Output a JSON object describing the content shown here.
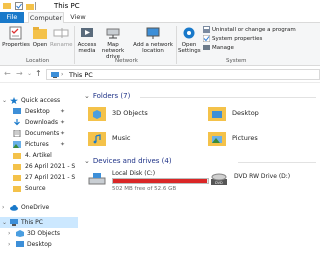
{
  "window": {
    "title": "This PC"
  },
  "tabs": {
    "file": "File",
    "computer": "Computer",
    "view": "View"
  },
  "ribbon": {
    "location": {
      "properties": "Properties",
      "open": "Open",
      "rename": "Rename",
      "label": "Location"
    },
    "network": {
      "access_media": "Access media",
      "map_network_drive": "Map network drive",
      "add_network_location": "Add a network location",
      "label": "Network"
    },
    "system": {
      "open_settings": "Open Settings",
      "uninstall": "Uninstall or change a program",
      "system_properties": "System properties",
      "manage": "Manage",
      "label": "System"
    }
  },
  "address": {
    "path": "This PC"
  },
  "nav": {
    "quick_access": "Quick access",
    "items": [
      {
        "label": "Desktop",
        "pinned": true
      },
      {
        "label": "Downloads",
        "pinned": true
      },
      {
        "label": "Documents",
        "pinned": true
      },
      {
        "label": "Pictures",
        "pinned": true
      },
      {
        "label": "4. Artikel",
        "pinned": false
      },
      {
        "label": "26 April 2021 - S",
        "pinned": false
      },
      {
        "label": "27 April 2021 - S",
        "pinned": false
      },
      {
        "label": "Source",
        "pinned": false
      }
    ],
    "onedrive": "OneDrive",
    "this_pc": "This PC",
    "pc_items": [
      "3D Objects",
      "Desktop"
    ]
  },
  "content": {
    "folders_header": "Folders (7)",
    "folders": [
      "3D Objects",
      "Desktop",
      "Music",
      "Pictures"
    ],
    "drives_header": "Devices and drives (4)",
    "drives": [
      {
        "name": "Local Disk (C:)",
        "free": "502 MB free of 52.6 GB",
        "used_fraction": 0.99
      },
      {
        "name": "DVD RW Drive (D:)"
      }
    ]
  },
  "colors": {
    "accent": "#1979ca",
    "folder": "#f4c24a",
    "drive_full": "#da2626",
    "selection": "#cce8ff"
  }
}
